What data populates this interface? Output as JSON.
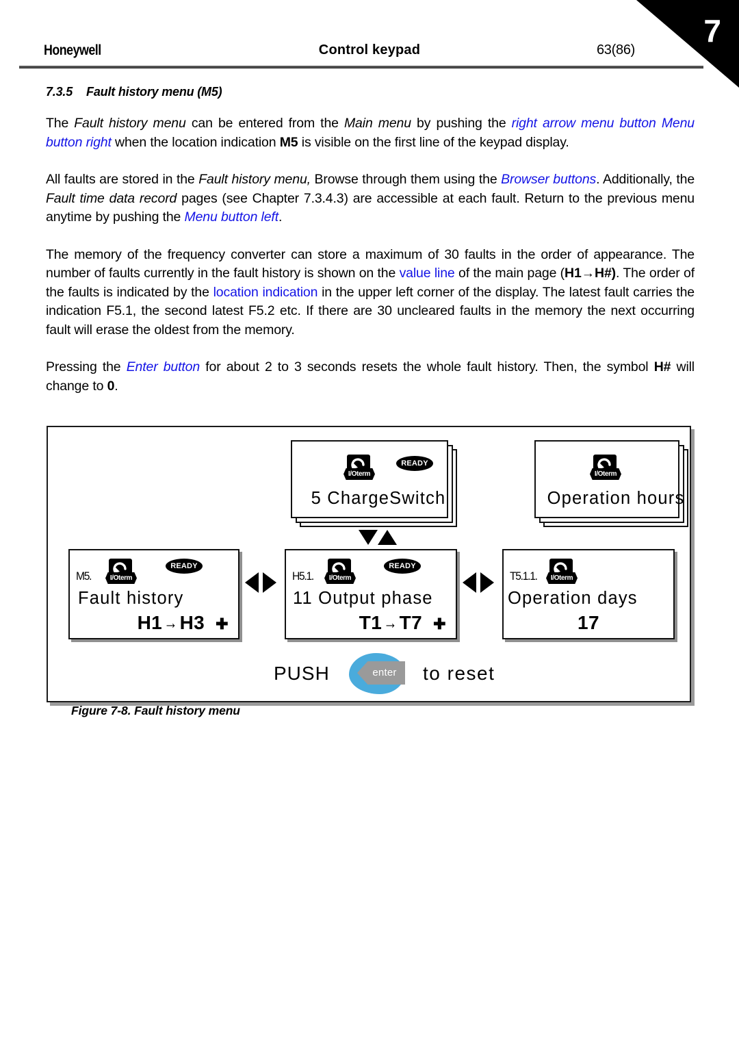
{
  "header": {
    "brand": "Honeywell",
    "title": "Control keypad",
    "page": "63(86)",
    "chapter_tab": "7"
  },
  "section": {
    "number": "7.3.5",
    "title": "Fault history menu (M5)"
  },
  "paragraphs": {
    "p1": {
      "t1": "The ",
      "i1": "Fault history menu",
      "t2": " can be entered from the ",
      "i2": "Main menu",
      "t3": " by pushing the ",
      "blue1": "right arrow menu button Menu button right",
      "t4": " when the location indication ",
      "b1": "M5",
      "t5": " is visible on the first line of the keypad display."
    },
    "p2": {
      "t1": "All faults are stored in the ",
      "i1": "Fault history menu,",
      "t2": "  Browse through them using the ",
      "blue1": "Browser buttons",
      "t3": ". Additionally, the ",
      "i2": "Fault time data record",
      "t4": " pages (see Chapter 7.3.4.3) are accessible at each fault. Return to the previous menu anytime by pushing the ",
      "blue2": "Menu button left",
      "t5": "."
    },
    "p3": {
      "t1": "The memory of the frequency converter can store a maximum of 30 faults in the order of appearance. The number of faults currently in the fault history is shown on the ",
      "blue1": "value line",
      "t2": " of the main page (",
      "b1": "H1",
      "arrow1": "→",
      "b2": "H#)",
      "t3": ". The order of the faults is indicated by the ",
      "blue2": "location indication",
      "t4": " in the upper left corner of the display. The latest fault carries the indication F5.1, the second latest F5.2 etc. If there are 30 uncleared faults in the memory the next occurring fault will erase the oldest from the memory."
    },
    "p4": {
      "t1": "Pressing the ",
      "blue1": "Enter button",
      "t2": " for about 2 to 3 seconds resets the whole fault history. Then, the symbol ",
      "b1": "H#",
      "t3": " will change to ",
      "b2": "0",
      "t4": "."
    }
  },
  "figure": {
    "caption": "Figure 7-8. Fault history menu",
    "panels": {
      "fault_history": {
        "location": "M5.",
        "status": "READY",
        "io_badge": "I/Oterm",
        "line1": "Fault history",
        "value_from": "H1",
        "value_arrow": "→",
        "value_to": "H3",
        "value_plus": "✚"
      },
      "output_phase": {
        "location": "H5.1.",
        "status": "READY",
        "io_badge": "I/Oterm",
        "line1": "11 Output phase",
        "value_from": "T1",
        "value_arrow": "→",
        "value_to": "T7",
        "value_plus": "✚"
      },
      "operation_days": {
        "location": "T5.1.1.",
        "io_badge": "I/Oterm",
        "line1": "Operation days",
        "value": "17"
      },
      "charge_switch": {
        "status": "READY",
        "io_badge": "I/Oterm",
        "line1": "5 ChargeSwitch"
      },
      "operation_hours": {
        "io_badge": "I/Oterm",
        "line1": "Operation hours"
      }
    },
    "push_row": {
      "push": "PUSH",
      "enter": "enter",
      "to_reset": "to reset"
    }
  },
  "colors": {
    "link_blue": "#1414e6",
    "enter_blob": "#4aabdc",
    "enter_key": "#9a9a9a",
    "tab_black": "#000000"
  }
}
